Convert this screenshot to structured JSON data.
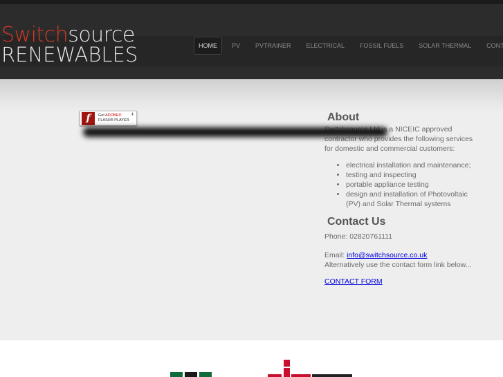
{
  "logo": {
    "part1": "Switch",
    "part2": "source",
    "line2": "RENEWABLES"
  },
  "nav": [
    "HOME",
    "PV",
    "PVTRAINER",
    "ELECTRICAL",
    "FOSSIL FUELS",
    "SOLAR THERMAL",
    "CONTACT"
  ],
  "flash": {
    "get": "Get ",
    "adobe": "ADOBE®",
    "player": "FLASH® PLAYER"
  },
  "about": {
    "title": "About",
    "intro": "Switchsource Ltd is a NICEIC approved contractor who provides the following services for domestic and commercial customers:",
    "services": [
      "electrical installation and maintenance;",
      "testing and inspecting",
      "portable appliance testing",
      "design and installation of Photovoltaic (PV) and Solar Thermal systems"
    ]
  },
  "contact": {
    "title": "Contact Us",
    "phone": "Phone: 02820761111",
    "email_label": "Email: ",
    "email": "info@switchsource.co.uk",
    "alt": "Alternatively use the contact form link below...",
    "form_link": "CONTACT FORM"
  },
  "colors": {
    "brand_red": "#d23a22",
    "header": "#2c2c2c",
    "link": "#0000dd"
  }
}
